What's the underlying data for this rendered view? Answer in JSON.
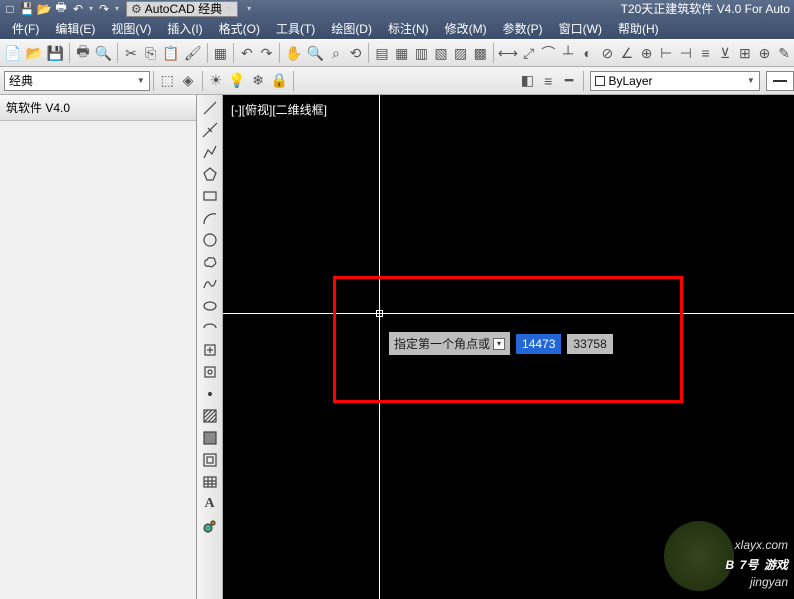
{
  "title": "T20天正建筑软件 V4.0 For Auto",
  "workspace_dropdown": "AutoCAD 经典",
  "menu": {
    "file": "件(F)",
    "edit": "编辑(E)",
    "view": "视图(V)",
    "insert": "插入(I)",
    "format": "格式(O)",
    "tools": "工具(T)",
    "draw": "绘图(D)",
    "dimension": "标注(N)",
    "modify": "修改(M)",
    "parametric": "参数(P)",
    "window": "窗口(W)",
    "help": "帮助(H)"
  },
  "workspace_combo": "经典",
  "layer_combo": "ByLayer",
  "panel": {
    "header": "筑软件 V4.0"
  },
  "viewport_label": "[-][俯视][二维线框]",
  "dynamic_input": {
    "prompt": "指定第一个角点或",
    "x": "14473",
    "y": "33758"
  },
  "watermark": {
    "brand_prefix": "B",
    "brand": "7号",
    "brand_suffix": "游戏",
    "url": "xlayx.com",
    "sub": "jingyan"
  }
}
